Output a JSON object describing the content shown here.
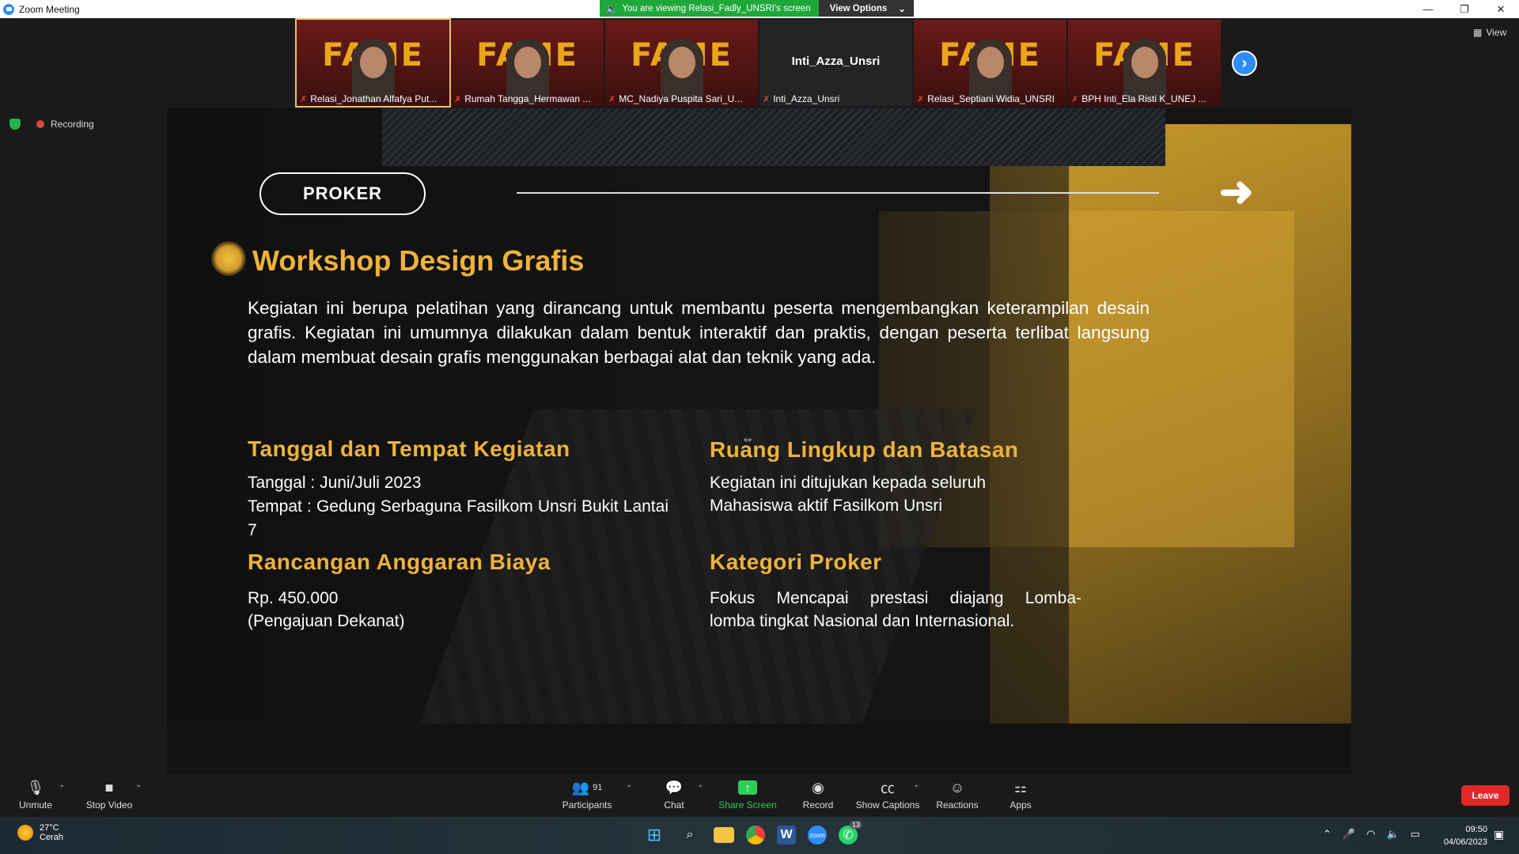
{
  "window": {
    "title": "Zoom Meeting",
    "controls": [
      "—",
      "❐",
      "✕"
    ]
  },
  "share_banner": {
    "viewing_text": "You are viewing Relasi_Fadly_UNSRI's screen",
    "options_label": "View Options"
  },
  "participants_strip": [
    {
      "name": "Relasi_Jonathan Alfafya Put...",
      "type": "video",
      "active": true
    },
    {
      "name": "Rumah Tangga_Hermawan ...",
      "type": "video"
    },
    {
      "name": "MC_Nadiya Puspita Sari_U...",
      "type": "video"
    },
    {
      "name": "Inti_Azza_Unsri",
      "type": "name",
      "display_name": "Inti_Azza_Unsri"
    },
    {
      "name": "Relasi_Septiani Widia_UNSRI",
      "type": "video"
    },
    {
      "name": "BPH Inti_Ela Risti K_UNEJ ...",
      "type": "video"
    }
  ],
  "thumb_banner_text": "FAME",
  "view_label": "View",
  "recording_label": "Recording",
  "slide": {
    "tag": "PROKER",
    "heading": "Workshop Design Grafis",
    "paragraph": "Kegiatan ini berupa pelatihan yang dirancang untuk membantu peserta mengembangkan keterampilan desain grafis. Kegiatan ini umumnya dilakukan dalam bentuk interaktif dan praktis, dengan peserta terlibat langsung dalam membuat desain grafis menggunakan berbagai alat dan teknik yang ada.",
    "section1_title": "Tanggal dan Tempat Kegiatan",
    "section1_line1": "Tanggal : Juni/Juli 2023",
    "section1_line2": "Tempat : Gedung Serbaguna Fasilkom Unsri Bukit Lantai 7",
    "section2_title": "Ruang Lingkup dan Batasan",
    "section2_line1": "Kegiatan ini ditujukan kepada seluruh",
    "section2_line2": "Mahasiswa aktif Fasilkom Unsri",
    "section3_title": "Rancangan Anggaran Biaya",
    "section3_line1": "Rp. 450.000",
    "section3_line2": "(Pengajuan Dekanat)",
    "section4_title": "Kategori Proker",
    "section4_line1": "Fokus Mencapai prestasi diajang Lomba-",
    "section4_line2": "lomba tingkat Nasional dan Internasional."
  },
  "toolbar": {
    "unmute": "Unmute",
    "stop_video": "Stop Video",
    "participants": "Participants",
    "participants_count": "91",
    "chat": "Chat",
    "share_screen": "Share Screen",
    "record": "Record",
    "show_captions": "Show Captions",
    "reactions": "Reactions",
    "apps": "Apps",
    "leave": "Leave"
  },
  "taskbar": {
    "temperature": "27°C",
    "weather": "Cerah",
    "time": "09:50",
    "date": "04/06/2023",
    "whatsapp_badge": "13"
  },
  "colors": {
    "accent_gold": "#f0b23a",
    "zoom_blue": "#2d8cff",
    "share_green": "#1fa83a",
    "leave_red": "#e02828"
  }
}
